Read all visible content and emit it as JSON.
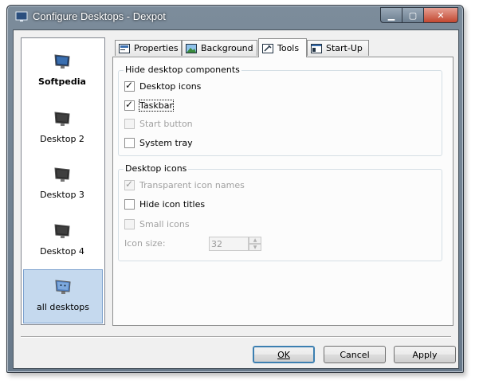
{
  "window": {
    "title": "Configure Desktops - Dexpot"
  },
  "desktops": [
    {
      "label": "Softpedia"
    },
    {
      "label": "Desktop 2"
    },
    {
      "label": "Desktop 3"
    },
    {
      "label": "Desktop 4"
    },
    {
      "label": "all desktops"
    }
  ],
  "tabs": [
    {
      "label": "Properties"
    },
    {
      "label": "Background"
    },
    {
      "label": "Tools"
    },
    {
      "label": "Start-Up"
    }
  ],
  "hide_components": {
    "title": "Hide desktop components",
    "items": [
      {
        "label": "Desktop icons",
        "checked": true
      },
      {
        "label": "Taskbar",
        "checked": true
      },
      {
        "label": "Start button",
        "checked": false
      },
      {
        "label": "System tray",
        "checked": false
      }
    ]
  },
  "desktop_icons": {
    "title": "Desktop icons",
    "items": [
      {
        "label": "Transparent icon names",
        "checked": true
      },
      {
        "label": "Hide icon titles",
        "checked": false
      },
      {
        "label": "Small icons",
        "checked": false
      }
    ],
    "icon_size_label": "Icon size:",
    "icon_size_value": "32"
  },
  "buttons": {
    "ok": "OK",
    "cancel": "Cancel",
    "apply": "Apply"
  },
  "colors": {
    "selection": "#c5d9ee",
    "disabled_text": "#a0a0a0"
  }
}
